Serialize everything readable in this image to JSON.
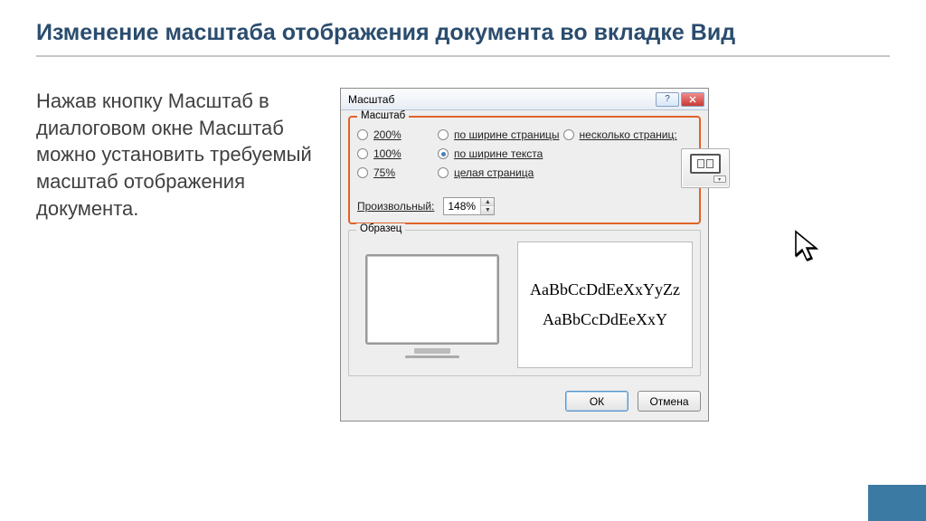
{
  "slide": {
    "title": "Изменение масштаба отображения документа во вкладке Вид",
    "body": "Нажав кнопку Масштаб в диалоговом окне Масштаб можно установить требуемый масштаб отображения документа."
  },
  "dialog": {
    "title": "Масштаб",
    "help_icon": "?",
    "groups": {
      "zoom": {
        "legend": "Масштаб",
        "options": {
          "p200": "200%",
          "p100": "100%",
          "p75": "75%",
          "page_width": "по ширине страницы",
          "text_width": "по ширине текста",
          "whole_page": "целая страница",
          "many_pages": "несколько страниц:"
        },
        "selected": "text_width",
        "custom_label": "Произвольный:",
        "custom_value": "148%"
      },
      "sample": {
        "legend": "Образец",
        "line1": "AaBbCcDdEeXxYyZz",
        "line2": "AaBbCcDdEeXxY"
      }
    },
    "buttons": {
      "ok": "ОК",
      "cancel": "Отмена"
    }
  }
}
